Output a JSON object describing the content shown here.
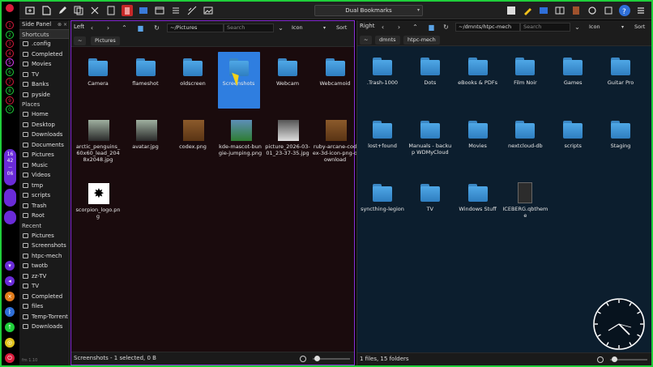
{
  "toolbar": {
    "bookmarks_label": "Dual Bookmarks"
  },
  "dock": {
    "workspaces": [
      "1",
      "2",
      "3",
      "4",
      "5",
      "6",
      "7",
      "8",
      "9",
      "0"
    ],
    "clock_lines": [
      "16",
      "42",
      "--",
      "06"
    ],
    "colors": {
      "purple": "#6a2bd8",
      "green": "#1fcf3a",
      "red": "#d81b3c"
    }
  },
  "side": {
    "title": "Side Panel",
    "shortcuts_label": "Shortcuts",
    "shortcuts": [
      ".config",
      "Completed",
      "Movies",
      "TV",
      "Banks",
      "pyside"
    ],
    "places_label": "Places",
    "places": [
      "Home",
      "Desktop",
      "Downloads",
      "Documents",
      "Pictures",
      "Music",
      "Videos",
      "tmp",
      "scripts",
      "Trash",
      "Root"
    ],
    "recent_label": "Recent",
    "recent": [
      "Pictures",
      "Screenshots",
      "htpc-mech",
      "twotb",
      "zz-TV",
      "TV",
      "Completed",
      "files",
      "Temp-Torrent",
      "Downloads"
    ],
    "footer": "fm 1.10"
  },
  "left": {
    "label": "Left",
    "path": "~/Pictures",
    "search_placeholder": "Search",
    "view": "Icon",
    "sort": "Sort",
    "crumbs": [
      "~",
      "Pictures"
    ],
    "items": [
      {
        "name": "Camera",
        "kind": "folder"
      },
      {
        "name": "flameshot",
        "kind": "folder"
      },
      {
        "name": "oldscreen",
        "kind": "folder"
      },
      {
        "name": "Screenshots",
        "kind": "folder",
        "selected": true
      },
      {
        "name": "Webcam",
        "kind": "folder"
      },
      {
        "name": "Webcamoid",
        "kind": "folder"
      },
      {
        "name": "arctic_penguins_60x60_lead_2048x2048.jpg",
        "kind": "penguins"
      },
      {
        "name": "avatar.jpg",
        "kind": "penguins"
      },
      {
        "name": "codex.png",
        "kind": "book"
      },
      {
        "name": "kde-mascot-bungie-jumping.png",
        "kind": "mascot"
      },
      {
        "name": "picture_2026-03-01_23-37-35.jpg",
        "kind": "photo"
      },
      {
        "name": "ruby-arcane-codex-3d-icon-png-download",
        "kind": "book"
      },
      {
        "name": "scorpion_logo.png",
        "kind": "scorpion"
      }
    ],
    "status": "Screenshots - 1 selected, 0 B"
  },
  "right": {
    "label": "Right",
    "path": "~/dmnts/htpc-mech",
    "search_placeholder": "Search",
    "view": "Icon",
    "sort": "Sort",
    "crumbs": [
      "~",
      "dmnts",
      "htpc-mech"
    ],
    "items": [
      {
        "name": ".Trash-1000",
        "kind": "folder"
      },
      {
        "name": "Dots",
        "kind": "folder"
      },
      {
        "name": "eBooks & PDFs",
        "kind": "folder"
      },
      {
        "name": "Film Noir",
        "kind": "folder"
      },
      {
        "name": "Games",
        "kind": "folder"
      },
      {
        "name": "Guitar Pro",
        "kind": "folder"
      },
      {
        "name": "lost+found",
        "kind": "folder"
      },
      {
        "name": "Manuals - backup WDMyCloud",
        "kind": "folder"
      },
      {
        "name": "Movies",
        "kind": "folder"
      },
      {
        "name": "nextcloud-db",
        "kind": "folder"
      },
      {
        "name": "scripts",
        "kind": "folder"
      },
      {
        "name": "Staging",
        "kind": "folder"
      },
      {
        "name": "syncthing-legion",
        "kind": "folder"
      },
      {
        "name": "TV",
        "kind": "folder"
      },
      {
        "name": "Windows Stuff",
        "kind": "folder"
      },
      {
        "name": "ICEBERG.qbtheme",
        "kind": "file"
      }
    ],
    "status": "1 files, 15 folders"
  }
}
